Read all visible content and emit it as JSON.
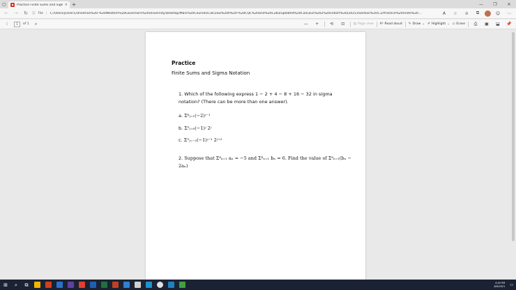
{
  "browser": {
    "tab_title": "Practice Finite Sums and Sigma",
    "tab_close": "×",
    "new_tab": "+",
    "file_label": "File",
    "url": "C:/Users/jsilver1/Onedrive%20-%20Western%20Governors%20University/Desktop/Main%20Courses/Calculus%20II%20-%20CQC%20and%20C283/updated%20Calculus%202%20cohort%20(2021)/Section%205.2/Practice%20Finite%20..."
  },
  "pdf_toolbar": {
    "page_value": "1",
    "page_of": "of 1",
    "zoom_out": "—",
    "zoom_in": "+",
    "page_view_label": "Page view",
    "read_aloud": "Read aloud",
    "draw": "Draw",
    "highlight": "Highlight",
    "erase": "Erase"
  },
  "document": {
    "title": "Practice",
    "subtitle": "Finite Sums and Sigma Notation",
    "q1_num": "1.",
    "q1_text": "Which of the following express 1 − 2 + 4 − 8 + 16 − 32 in sigma notation? (There can be more than one answer).",
    "options": [
      {
        "label": "a.",
        "expr": "Σ⁶ⱼ₌₁(−2)ʲ⁻¹"
      },
      {
        "label": "b.",
        "expr": "Σ⁵ⱼ₌₀(−1)ʲ 2ʲ"
      },
      {
        "label": "c.",
        "expr": "Σ³ⱼ₌₋₂(−1)ʲ⁻¹ 2ʲ⁺²"
      }
    ],
    "q2_num": "2.",
    "q2_text": "Suppose that Σ⁸ₙ₌₁ aₙ = −5 and Σ⁸ₙ₌₁ bₙ = 6. Find the value of Σ⁸ₙ₌₁(bₙ − 2aₙ)"
  },
  "taskbar": {
    "time": "4:45 PM",
    "date": "8/9/2021"
  },
  "colors": {
    "taskbar": "#1a2233",
    "viewer_bg": "#e9e9e9",
    "page_bg": "#ffffff"
  }
}
